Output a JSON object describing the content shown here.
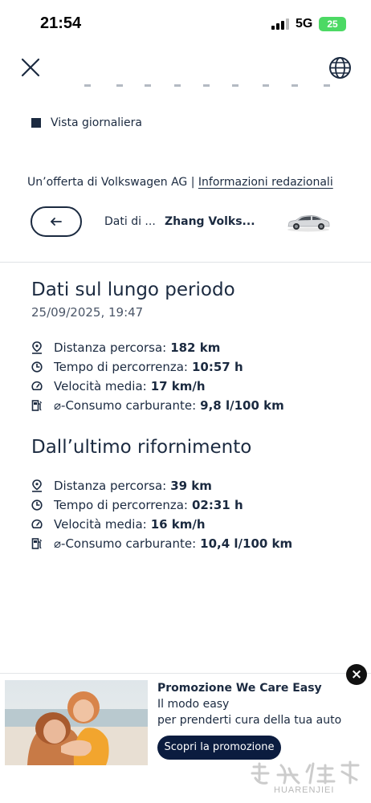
{
  "status_bar": {
    "time": "21:54",
    "network": "5G",
    "battery": "25"
  },
  "nav": {
    "close_icon": "close-icon",
    "language_icon": "globe-icon"
  },
  "chart_legend": {
    "label": "Vista giornaliera",
    "color": "#1b2a40"
  },
  "offer": {
    "text": "Un’offerta di Volkswagen AG |",
    "link": "Informazioni redazionali"
  },
  "vehicle_bar": {
    "back_icon": "arrow-left-icon",
    "label": "Dati di ...",
    "name": "Zhang Volks..."
  },
  "long_term": {
    "title": "Dati sul lungo periodo",
    "date": "25/09/2025, 19:47",
    "stats": [
      {
        "icon": "location-pin-icon",
        "label": "Distanza percorsa:",
        "value": "182 km"
      },
      {
        "icon": "clock-icon",
        "label": "Tempo di percorrenza:",
        "value": "10:57 h"
      },
      {
        "icon": "speedometer-icon",
        "label": "Velocità media:",
        "value": "17 km/h"
      },
      {
        "icon": "fuel-pump-icon",
        "label": "⌀-Consumo carburante:",
        "value": "9,8 l/100 km"
      }
    ]
  },
  "since_refuel": {
    "title": "Dall’ultimo rifornimento",
    "stats": [
      {
        "icon": "location-pin-icon",
        "label": "Distanza percorsa:",
        "value": "39 km"
      },
      {
        "icon": "clock-icon",
        "label": "Tempo di percorrenza:",
        "value": "02:31 h"
      },
      {
        "icon": "speedometer-icon",
        "label": "Velocità media:",
        "value": "16 km/h"
      },
      {
        "icon": "fuel-pump-icon",
        "label": "⌀-Consumo carburante:",
        "value": "10,4 l/100 km"
      }
    ]
  },
  "promo": {
    "title": "Promozione We Care Easy",
    "line1": "Il modo easy",
    "line2": "per prenderti cura della tua auto",
    "button": "Scopri la promozione",
    "close": "×",
    "watermark": "HUARENJIEI"
  },
  "colors": {
    "primary": "#1b2a40",
    "button": "#0b1c3f",
    "battery": "#4cd964"
  }
}
